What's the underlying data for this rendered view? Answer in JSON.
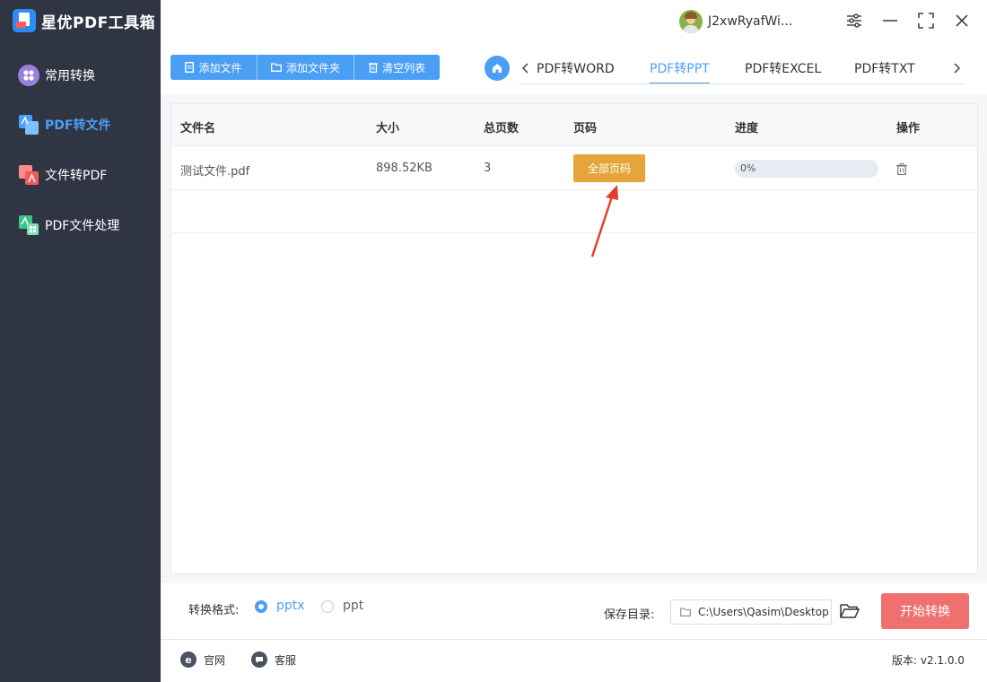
{
  "app": {
    "title": "星优PDF工具箱"
  },
  "sidebar": {
    "items": [
      {
        "label": "常用转换"
      },
      {
        "label": "PDF转文件"
      },
      {
        "label": "文件转PDF"
      },
      {
        "label": "PDF文件处理"
      }
    ]
  },
  "user": {
    "name": "J2xwRyafWi..."
  },
  "toolbar": {
    "add_file": "添加文件",
    "add_folder": "添加文件夹",
    "clear_list": "清空列表"
  },
  "tabs": [
    {
      "label": "PDF转WORD"
    },
    {
      "label": "PDF转PPT"
    },
    {
      "label": "PDF转EXCEL"
    },
    {
      "label": "PDF转TXT"
    }
  ],
  "table": {
    "headers": [
      "文件名",
      "大小",
      "总页数",
      "页码",
      "进度",
      "操作"
    ],
    "rows": [
      {
        "name": "测试文件.pdf",
        "size": "898.52KB",
        "pages": "3",
        "page_btn": "全部页码",
        "progress_text": "0%",
        "progress": 0
      }
    ]
  },
  "bottom": {
    "format_label": "转换格式:",
    "options": [
      "pptx",
      "ppt"
    ],
    "selected": "pptx",
    "save_label": "保存目录:",
    "save_path": "C:\\Users\\Qasim\\Desktop",
    "start": "开始转换"
  },
  "footer": {
    "website": "官网",
    "service": "客服",
    "version": "版本: v2.1.0.0"
  },
  "colors": {
    "accent": "#4a9ff5",
    "sidebar_bg": "#2f3542",
    "page_button": "#e6a53a",
    "start_button": "#f07070"
  }
}
